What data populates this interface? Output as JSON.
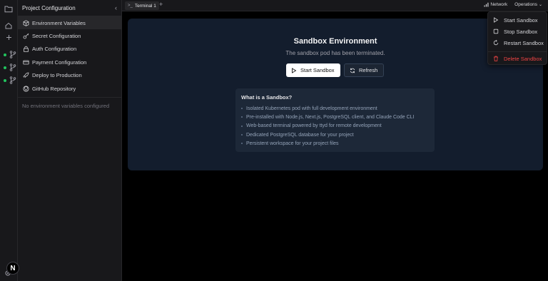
{
  "sidebar": {
    "title": "Project Configuration",
    "items": [
      {
        "label": "Environment Variables",
        "icon": "box-icon"
      },
      {
        "label": "Secret Configuration",
        "icon": "key-icon"
      },
      {
        "label": "Auth Configuration",
        "icon": "lock-icon"
      },
      {
        "label": "Payment Configuration",
        "icon": "credit-card-icon"
      },
      {
        "label": "Deploy to Production",
        "icon": "rocket-icon"
      },
      {
        "label": "GitHub Repository",
        "icon": "github-icon"
      }
    ],
    "empty_text": "No environment variables configured"
  },
  "rail": {
    "badge": "N",
    "status_color": "#22c55e"
  },
  "topbar": {
    "tab_label": "Terminal 1",
    "add_label": "+",
    "network_label": "Network",
    "operations_label": "Operations"
  },
  "main": {
    "title": "Sandbox Environment",
    "subtitle": "The sandbox pod has been terminated.",
    "start_label": "Start Sandbox",
    "refresh_label": "Refresh",
    "info_title": "What is a Sandbox?",
    "info_items": [
      "Isolated Kubernetes pod with full development environment",
      "Pre-installed with Node.js, Next.js, PostgreSQL client, and Claude Code CLI",
      "Web-based terminal powered by ttyd for remote development",
      "Dedicated PostgreSQL database for your project",
      "Persistent workspace for your project files"
    ]
  },
  "menu": {
    "items": [
      {
        "label": "Start Sandbox",
        "icon": "play-icon"
      },
      {
        "label": "Stop Sandbox",
        "icon": "stop-icon"
      },
      {
        "label": "Restart Sandbox",
        "icon": "restart-icon"
      },
      {
        "label": "Delete Sandbox",
        "icon": "trash-icon"
      }
    ],
    "danger_color": "#ef4444"
  }
}
